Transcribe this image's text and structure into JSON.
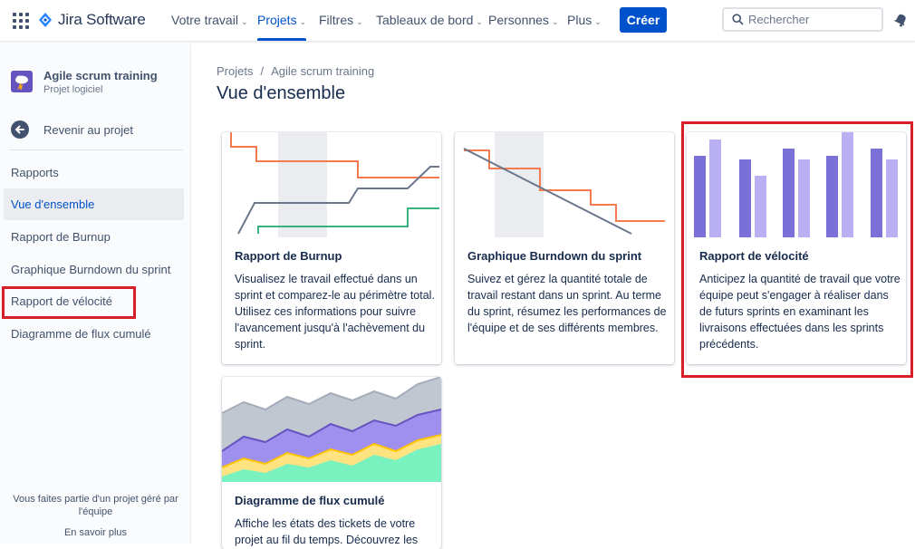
{
  "topnav": {
    "logo_text": "Jira Software",
    "items": [
      {
        "label": "Votre travail"
      },
      {
        "label": "Projets"
      },
      {
        "label": "Filtres"
      },
      {
        "label": "Tableaux de bord"
      },
      {
        "label": "Personnes"
      },
      {
        "label": "Plus"
      }
    ],
    "active_item": "Projets",
    "create_label": "Créer",
    "search_placeholder": "Rechercher"
  },
  "sidebar": {
    "project_name": "Agile scrum training",
    "project_type": "Projet logiciel",
    "back_label": "Revenir au projet",
    "section_title": "Rapports",
    "items": [
      {
        "label": "Vue d'ensemble"
      },
      {
        "label": "Rapport de Burnup"
      },
      {
        "label": "Graphique Burndown du sprint"
      },
      {
        "label": "Rapport de vélocité"
      },
      {
        "label": "Diagramme de flux cumulé"
      }
    ],
    "selected_item": "Vue d'ensemble",
    "footer_text": "Vous faites partie d'un projet géré par l'équipe",
    "learn_more": "En savoir plus"
  },
  "breadcrumb": {
    "root": "Projets",
    "separator": "/",
    "current": "Agile scrum training"
  },
  "page_title": "Vue d'ensemble",
  "cards": [
    {
      "title": "Rapport de Burnup",
      "description": "Visualisez le travail effectué dans un sprint et comparez-le au périmètre total. Utilisez ces informations pour suivre l'avancement jusqu'à l'achèvement du sprint."
    },
    {
      "title": "Graphique Burndown du sprint",
      "description": "Suivez et gérez la quantité totale de travail restant dans un sprint. Au terme du sprint, résumez les performances de l'équipe et de ses différents membres."
    },
    {
      "title": "Rapport de vélocité",
      "description": "Anticipez la quantité de travail que votre équipe peut s'engager à réaliser dans de futurs sprints en examinant les livraisons effectuées dans les sprints précédents."
    },
    {
      "title": "Diagramme de flux cumulé",
      "description": "Affiche les états des tickets de votre projet au fil du temps. Découvrez les"
    }
  ],
  "colors": {
    "brand": "#0052cc",
    "highlight": "#d61f26",
    "chart_orange": "#f37b4f",
    "chart_gray": "#6b778c",
    "chart_green": "#36b37e",
    "chart_purple_dark": "#7b6fd8",
    "chart_purple_light": "#b8b0f2"
  },
  "icons": [
    "apps-grid-icon",
    "jira-logo-icon",
    "search-icon",
    "notification-icon",
    "project-avatar-icon",
    "back-arrow-icon"
  ]
}
